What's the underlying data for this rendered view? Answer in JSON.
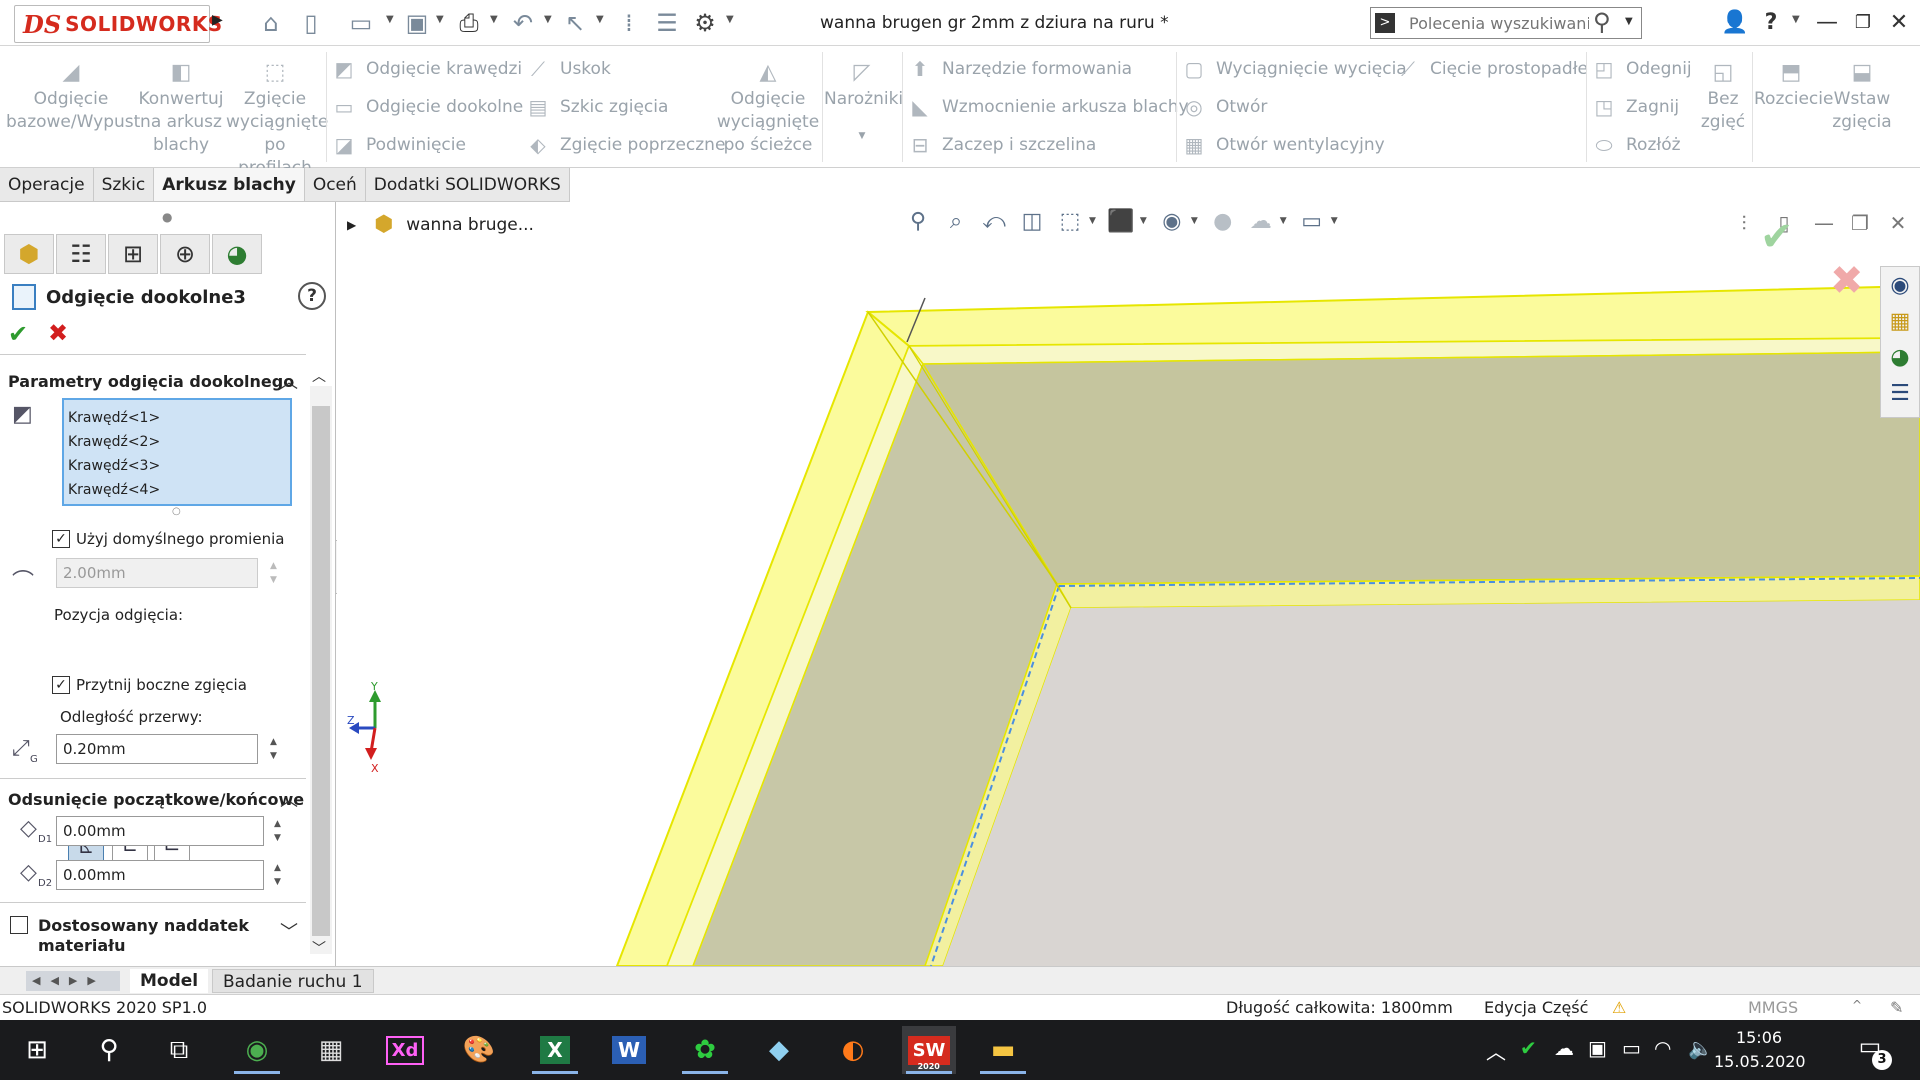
{
  "app": {
    "logo_ds": "DS",
    "logo_text": "SOLIDWORKS",
    "document_title": "wanna brugen gr 2mm z dziura na ruru *",
    "search_placeholder": "Polecenia wyszukiwania"
  },
  "ribbon": {
    "big": {
      "base_flange": "Odgięcie bazowe/Wypust",
      "convert": "Konwertuj na arkusz blachy",
      "lofted": "Zgięcie wyciągnięte po profilach",
      "swept": "Odgięcie wyciągnięte po ścieżce",
      "corners": "Narożniki",
      "no_bends": "Bez zgięć",
      "unfold": "Rozciecie",
      "insert_bends": "Wstaw zgięcia"
    },
    "small": {
      "edge_flange": "Odgięcie krawędzi",
      "miter_flange": "Odgięcie dookolne",
      "hem": "Podwinięcie",
      "jog": "Uskok",
      "sketched_bend": "Szkic zgięcia",
      "cross_break": "Zgięcie poprzeczne",
      "forming_tool": "Narzędzie formowania",
      "gusset": "Wzmocnienie arkusza blachy",
      "tab_slot": "Zaczep i szczelina",
      "extruded_cut": "Wyciągnięcie wycięcia",
      "normal_cut": "Cięcie prostopadłe",
      "hole": "Otwór",
      "vent": "Otwór wentylacyjny",
      "unfold": "Odegnij",
      "fold": "Zagnij",
      "flatten": "Rozłóż"
    }
  },
  "tabs": [
    "Operacje",
    "Szkic",
    "Arkusz blachy",
    "Oceń",
    "Dodatki SOLIDWORKS"
  ],
  "property_manager": {
    "title": "Odgięcie dookolne3",
    "help": "?",
    "group1_title": "Parametry odgięcia dookolnego",
    "edges": [
      "Krawędź<1>",
      "Krawędź<2>",
      "Krawędź<3>",
      "Krawędź<4>"
    ],
    "use_default_radius_label": "Użyj domyślnego promienia",
    "use_default_radius_checked": true,
    "radius_value": "2.00mm",
    "flange_position_label": "Pozycja odgięcia:",
    "trim_side_bends_label": "Przytnij boczne zgięcia",
    "trim_side_bends_checked": true,
    "gap_distance_label": "Odległość przerwy:",
    "gap_value": "0.20mm",
    "group2_title": "Odsunięcie początkowe/końcowe",
    "start_offset": "0.00mm",
    "end_offset": "0.00mm",
    "custom_allowance_label": "Dostosowany naddatek materiału",
    "custom_allowance_checked": false,
    "d1_label": "D1",
    "d2_label": "D2",
    "gap_sub": "G"
  },
  "tree": {
    "item": "wanna bruge..."
  },
  "bottom_tabs": {
    "model": "Model",
    "motion": "Badanie ruchu 1"
  },
  "status": {
    "version": "SOLIDWORKS 2020 SP1.0",
    "length": "Długość całkowita: 1800mm",
    "mode": "Edycja Część",
    "units": "MMGS",
    "units_caret": "^"
  },
  "triad": {
    "x": "X",
    "y": "Y",
    "z": "Z"
  },
  "taskbar": {
    "time": "15:06",
    "date": "15.05.2020",
    "notifications": "3",
    "sw_year": "2020",
    "xd": "Xd",
    "excel": "X",
    "word": "W"
  },
  "colors": {
    "accent_blue": "#3a7fc1",
    "selection_yellow": "#f5f500",
    "ok_green": "#2e9b2e",
    "cancel_red": "#d21e1e",
    "sw_red": "#d52b1e"
  }
}
